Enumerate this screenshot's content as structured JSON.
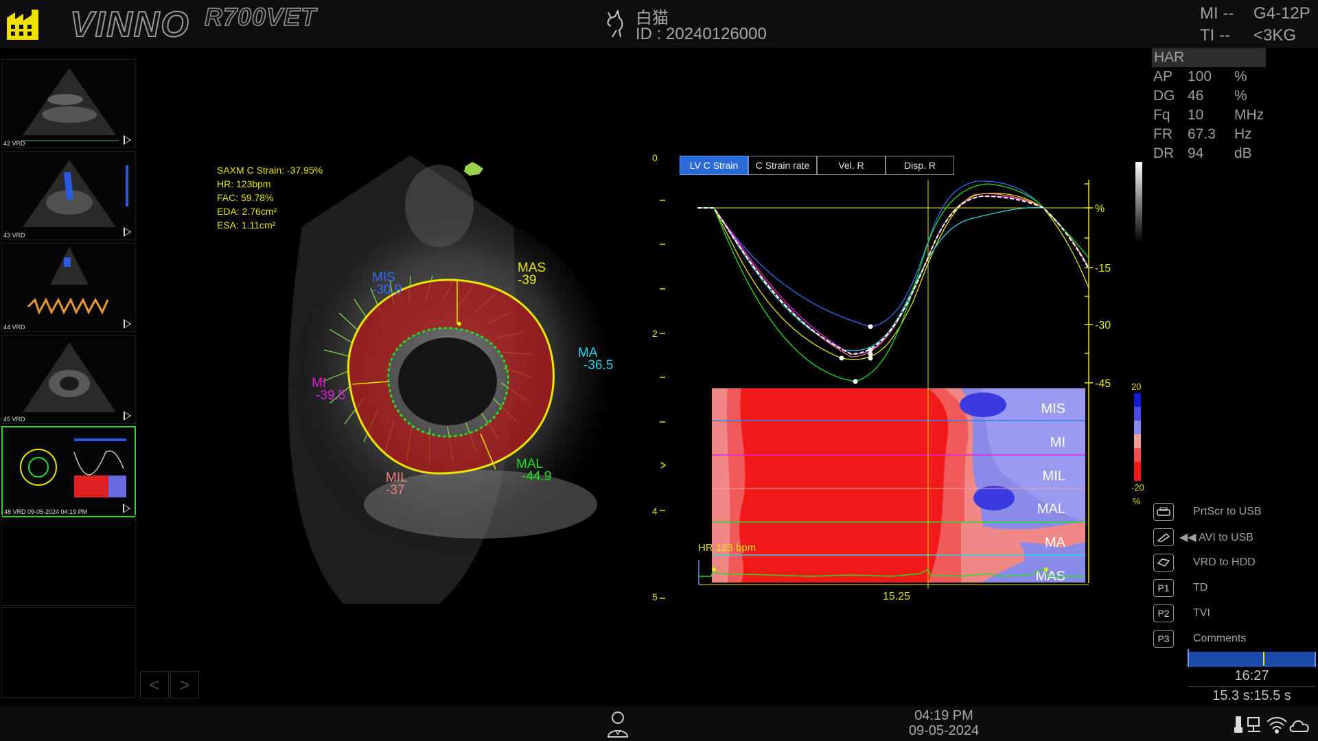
{
  "header": {
    "brand": "VINNO",
    "model": "R700VET",
    "patient_name": "白猫",
    "patient_id": "ID :  20240126000",
    "mi": "MI --",
    "ti": "TI --",
    "probe": "G4-12P",
    "weight": "<3KG"
  },
  "thumbnails": [
    {
      "caption": "42 VRD"
    },
    {
      "caption": "43 VRD"
    },
    {
      "caption": "44 VRD"
    },
    {
      "caption": "45 VRD"
    },
    {
      "caption": "48 VRD 09-05-2024 04:19 PM"
    }
  ],
  "nav": {
    "prev": "<",
    "next": ">"
  },
  "measurements": [
    "SAXM C Strain: -37.95%",
    "HR:  123bpm",
    "FAC: 59.78%",
    "EDA: 2.76cm²",
    "ESA: 1.11cm²"
  ],
  "segments": {
    "mis": {
      "name": "MIS",
      "value": "-30.9",
      "color": "#2f6ef0"
    },
    "mas": {
      "name": "MAS",
      "value": "-39",
      "color": "#e8e800"
    },
    "ma": {
      "name": "MA",
      "value": "-36.5",
      "color": "#22d8e8"
    },
    "mi": {
      "name": "MI",
      "value": "-39.5",
      "color": "#e020e0"
    },
    "mil": {
      "name": "MIL",
      "value": "-37",
      "color": "#f08080"
    },
    "mal": {
      "name": "MAL",
      "value": "-44.9",
      "color": "#22e022"
    }
  },
  "depth_scale": [
    "0",
    "2",
    "4",
    "5"
  ],
  "tabs": [
    {
      "label": "LV C Strain",
      "active": true
    },
    {
      "label": "C Strain rate",
      "active": false
    },
    {
      "label": "Vel. R",
      "active": false
    },
    {
      "label": "Disp. R",
      "active": false
    }
  ],
  "chart": {
    "y_unit": "%",
    "y_ticks": [
      "-15",
      "-30",
      "-45"
    ],
    "x_cursor": "15.25",
    "hr_label": "HR 123 bpm",
    "heatmap_labels": [
      "MIS",
      "MI",
      "MIL",
      "MAL",
      "MA",
      "MAS"
    ],
    "scale_max": "20",
    "scale_min": "-20",
    "scale_unit": "%"
  },
  "params": {
    "mode": "HAR",
    "rows": [
      {
        "name": "AP",
        "value": "100",
        "unit": "%"
      },
      {
        "name": "DG",
        "value": "46",
        "unit": "%"
      },
      {
        "name": "Fq",
        "value": "10",
        "unit": "MHz"
      },
      {
        "name": "FR",
        "value": "67.3",
        "unit": "Hz"
      },
      {
        "name": "DR",
        "value": "94",
        "unit": "dB"
      }
    ]
  },
  "actions": [
    {
      "key": "",
      "label": "PrtScr to USB",
      "icon": "printer-icon"
    },
    {
      "key": "",
      "label": "◀◀ AVI to USB",
      "icon": "usb-drive-icon"
    },
    {
      "key": "",
      "label": "VRD to HDD",
      "icon": "hdd-icon"
    },
    {
      "key": "P1",
      "label": "TD",
      "icon": "p1-key"
    },
    {
      "key": "P2",
      "label": "TVI",
      "icon": "p2-key"
    },
    {
      "key": "P3",
      "label": "Comments",
      "icon": "p3-key"
    }
  ],
  "cine": {
    "time": "16:27",
    "range": "15.3 s:15.5 s"
  },
  "footer": {
    "time": "04:19 PM",
    "date": "09-05-2024"
  }
}
